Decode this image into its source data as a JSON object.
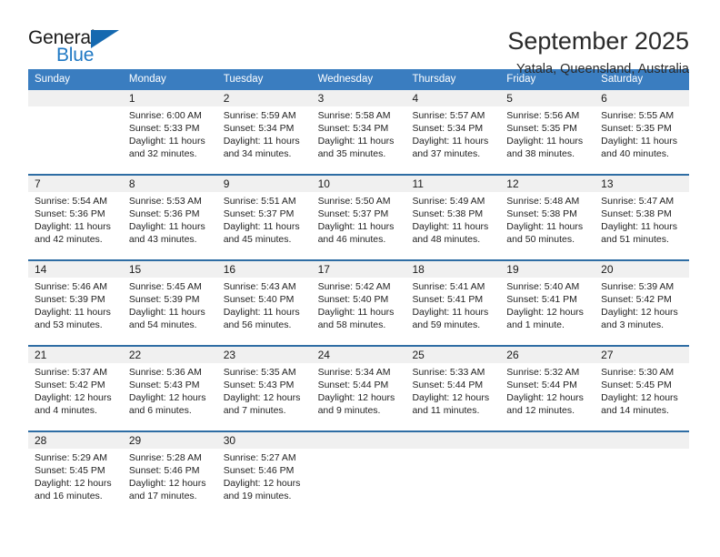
{
  "brand": {
    "name_top": "General",
    "name_bottom": "Blue",
    "triangle_color": "#1569b0",
    "blue_text_color": "#2079c4"
  },
  "header": {
    "title": "September 2025",
    "location": "Yatala, Queensland, Australia"
  },
  "calendar": {
    "header_bg": "#3a7dc0",
    "header_text_color": "#ffffff",
    "row_divider_color": "#2e6da4",
    "daynum_band_bg": "#f0f0f0",
    "weekdays": [
      "Sunday",
      "Monday",
      "Tuesday",
      "Wednesday",
      "Thursday",
      "Friday",
      "Saturday"
    ],
    "weeks": [
      [
        {
          "day": "",
          "sunrise": "",
          "sunset": "",
          "daylight_line1": "",
          "daylight_line2": ""
        },
        {
          "day": "1",
          "sunrise": "Sunrise: 6:00 AM",
          "sunset": "Sunset: 5:33 PM",
          "daylight_line1": "Daylight: 11 hours",
          "daylight_line2": "and 32 minutes."
        },
        {
          "day": "2",
          "sunrise": "Sunrise: 5:59 AM",
          "sunset": "Sunset: 5:34 PM",
          "daylight_line1": "Daylight: 11 hours",
          "daylight_line2": "and 34 minutes."
        },
        {
          "day": "3",
          "sunrise": "Sunrise: 5:58 AM",
          "sunset": "Sunset: 5:34 PM",
          "daylight_line1": "Daylight: 11 hours",
          "daylight_line2": "and 35 minutes."
        },
        {
          "day": "4",
          "sunrise": "Sunrise: 5:57 AM",
          "sunset": "Sunset: 5:34 PM",
          "daylight_line1": "Daylight: 11 hours",
          "daylight_line2": "and 37 minutes."
        },
        {
          "day": "5",
          "sunrise": "Sunrise: 5:56 AM",
          "sunset": "Sunset: 5:35 PM",
          "daylight_line1": "Daylight: 11 hours",
          "daylight_line2": "and 38 minutes."
        },
        {
          "day": "6",
          "sunrise": "Sunrise: 5:55 AM",
          "sunset": "Sunset: 5:35 PM",
          "daylight_line1": "Daylight: 11 hours",
          "daylight_line2": "and 40 minutes."
        }
      ],
      [
        {
          "day": "7",
          "sunrise": "Sunrise: 5:54 AM",
          "sunset": "Sunset: 5:36 PM",
          "daylight_line1": "Daylight: 11 hours",
          "daylight_line2": "and 42 minutes."
        },
        {
          "day": "8",
          "sunrise": "Sunrise: 5:53 AM",
          "sunset": "Sunset: 5:36 PM",
          "daylight_line1": "Daylight: 11 hours",
          "daylight_line2": "and 43 minutes."
        },
        {
          "day": "9",
          "sunrise": "Sunrise: 5:51 AM",
          "sunset": "Sunset: 5:37 PM",
          "daylight_line1": "Daylight: 11 hours",
          "daylight_line2": "and 45 minutes."
        },
        {
          "day": "10",
          "sunrise": "Sunrise: 5:50 AM",
          "sunset": "Sunset: 5:37 PM",
          "daylight_line1": "Daylight: 11 hours",
          "daylight_line2": "and 46 minutes."
        },
        {
          "day": "11",
          "sunrise": "Sunrise: 5:49 AM",
          "sunset": "Sunset: 5:38 PM",
          "daylight_line1": "Daylight: 11 hours",
          "daylight_line2": "and 48 minutes."
        },
        {
          "day": "12",
          "sunrise": "Sunrise: 5:48 AM",
          "sunset": "Sunset: 5:38 PM",
          "daylight_line1": "Daylight: 11 hours",
          "daylight_line2": "and 50 minutes."
        },
        {
          "day": "13",
          "sunrise": "Sunrise: 5:47 AM",
          "sunset": "Sunset: 5:38 PM",
          "daylight_line1": "Daylight: 11 hours",
          "daylight_line2": "and 51 minutes."
        }
      ],
      [
        {
          "day": "14",
          "sunrise": "Sunrise: 5:46 AM",
          "sunset": "Sunset: 5:39 PM",
          "daylight_line1": "Daylight: 11 hours",
          "daylight_line2": "and 53 minutes."
        },
        {
          "day": "15",
          "sunrise": "Sunrise: 5:45 AM",
          "sunset": "Sunset: 5:39 PM",
          "daylight_line1": "Daylight: 11 hours",
          "daylight_line2": "and 54 minutes."
        },
        {
          "day": "16",
          "sunrise": "Sunrise: 5:43 AM",
          "sunset": "Sunset: 5:40 PM",
          "daylight_line1": "Daylight: 11 hours",
          "daylight_line2": "and 56 minutes."
        },
        {
          "day": "17",
          "sunrise": "Sunrise: 5:42 AM",
          "sunset": "Sunset: 5:40 PM",
          "daylight_line1": "Daylight: 11 hours",
          "daylight_line2": "and 58 minutes."
        },
        {
          "day": "18",
          "sunrise": "Sunrise: 5:41 AM",
          "sunset": "Sunset: 5:41 PM",
          "daylight_line1": "Daylight: 11 hours",
          "daylight_line2": "and 59 minutes."
        },
        {
          "day": "19",
          "sunrise": "Sunrise: 5:40 AM",
          "sunset": "Sunset: 5:41 PM",
          "daylight_line1": "Daylight: 12 hours",
          "daylight_line2": "and 1 minute."
        },
        {
          "day": "20",
          "sunrise": "Sunrise: 5:39 AM",
          "sunset": "Sunset: 5:42 PM",
          "daylight_line1": "Daylight: 12 hours",
          "daylight_line2": "and 3 minutes."
        }
      ],
      [
        {
          "day": "21",
          "sunrise": "Sunrise: 5:37 AM",
          "sunset": "Sunset: 5:42 PM",
          "daylight_line1": "Daylight: 12 hours",
          "daylight_line2": "and 4 minutes."
        },
        {
          "day": "22",
          "sunrise": "Sunrise: 5:36 AM",
          "sunset": "Sunset: 5:43 PM",
          "daylight_line1": "Daylight: 12 hours",
          "daylight_line2": "and 6 minutes."
        },
        {
          "day": "23",
          "sunrise": "Sunrise: 5:35 AM",
          "sunset": "Sunset: 5:43 PM",
          "daylight_line1": "Daylight: 12 hours",
          "daylight_line2": "and 7 minutes."
        },
        {
          "day": "24",
          "sunrise": "Sunrise: 5:34 AM",
          "sunset": "Sunset: 5:44 PM",
          "daylight_line1": "Daylight: 12 hours",
          "daylight_line2": "and 9 minutes."
        },
        {
          "day": "25",
          "sunrise": "Sunrise: 5:33 AM",
          "sunset": "Sunset: 5:44 PM",
          "daylight_line1": "Daylight: 12 hours",
          "daylight_line2": "and 11 minutes."
        },
        {
          "day": "26",
          "sunrise": "Sunrise: 5:32 AM",
          "sunset": "Sunset: 5:44 PM",
          "daylight_line1": "Daylight: 12 hours",
          "daylight_line2": "and 12 minutes."
        },
        {
          "day": "27",
          "sunrise": "Sunrise: 5:30 AM",
          "sunset": "Sunset: 5:45 PM",
          "daylight_line1": "Daylight: 12 hours",
          "daylight_line2": "and 14 minutes."
        }
      ],
      [
        {
          "day": "28",
          "sunrise": "Sunrise: 5:29 AM",
          "sunset": "Sunset: 5:45 PM",
          "daylight_line1": "Daylight: 12 hours",
          "daylight_line2": "and 16 minutes."
        },
        {
          "day": "29",
          "sunrise": "Sunrise: 5:28 AM",
          "sunset": "Sunset: 5:46 PM",
          "daylight_line1": "Daylight: 12 hours",
          "daylight_line2": "and 17 minutes."
        },
        {
          "day": "30",
          "sunrise": "Sunrise: 5:27 AM",
          "sunset": "Sunset: 5:46 PM",
          "daylight_line1": "Daylight: 12 hours",
          "daylight_line2": "and 19 minutes."
        },
        {
          "day": "",
          "sunrise": "",
          "sunset": "",
          "daylight_line1": "",
          "daylight_line2": ""
        },
        {
          "day": "",
          "sunrise": "",
          "sunset": "",
          "daylight_line1": "",
          "daylight_line2": ""
        },
        {
          "day": "",
          "sunrise": "",
          "sunset": "",
          "daylight_line1": "",
          "daylight_line2": ""
        },
        {
          "day": "",
          "sunrise": "",
          "sunset": "",
          "daylight_line1": "",
          "daylight_line2": ""
        }
      ]
    ]
  }
}
